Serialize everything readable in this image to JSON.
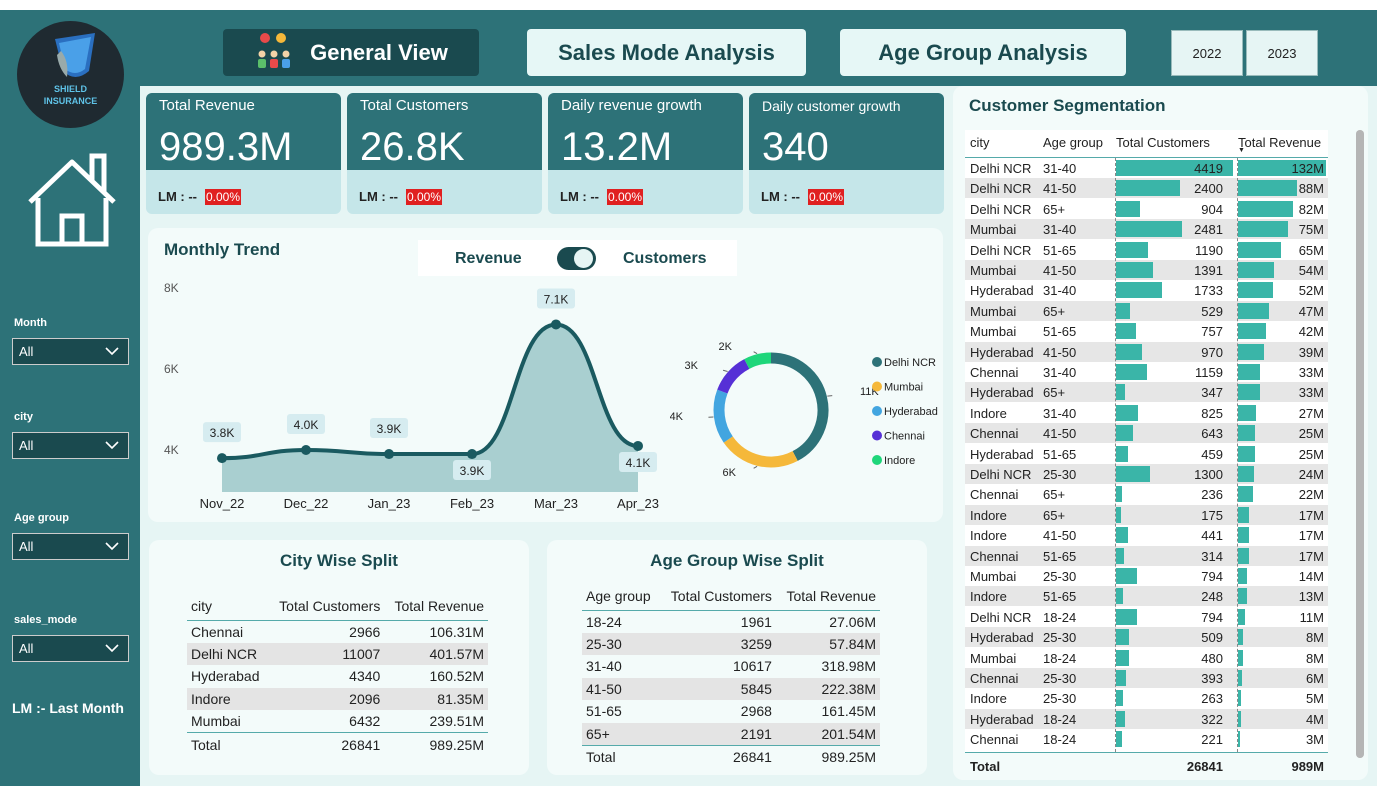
{
  "logo": {
    "text1": "SHIELD",
    "text2": "INSURANCE"
  },
  "nav": {
    "general": "General View",
    "sales": "Sales Mode Analysis",
    "age": "Age Group Analysis"
  },
  "years": [
    "2022",
    "2023"
  ],
  "kpis": [
    {
      "label": "Total Revenue",
      "value": "989.3M",
      "lm": "LM : --",
      "pct": "0.00%"
    },
    {
      "label": "Total Customers",
      "value": "26.8K",
      "lm": "LM : --",
      "pct": "0.00%"
    },
    {
      "label": "Daily revenue growth",
      "value": "13.2M",
      "lm": "LM : --",
      "pct": "0.00%"
    },
    {
      "label": "Daily customer growth",
      "value": "340",
      "lm": "LM : --",
      "pct": "0.00%"
    }
  ],
  "slicers": [
    {
      "label": "Month",
      "value": "All"
    },
    {
      "label": "city",
      "value": "All"
    },
    {
      "label": "Age group",
      "value": "All"
    },
    {
      "label": "sales_mode",
      "value": "All"
    }
  ],
  "lm_note": "LM :- Last Month",
  "monthly": {
    "title": "Monthly Trend",
    "toggle_left": "Revenue",
    "toggle_right": "Customers",
    "yticks": [
      "8K",
      "6K",
      "4K"
    ]
  },
  "chart_data": [
    {
      "type": "area",
      "title": "Monthly Trend",
      "x": [
        "Nov_22",
        "Dec_22",
        "Jan_23",
        "Feb_23",
        "Mar_23",
        "Apr_23"
      ],
      "values": [
        3.8,
        4.0,
        3.9,
        3.9,
        7.1,
        4.1
      ],
      "labels": [
        "3.8K",
        "4.0K",
        "3.9K",
        "3.9K",
        "7.1K",
        "4.1K"
      ],
      "yticks": [
        "8K",
        "6K",
        "4K"
      ],
      "color": "#1a5a60"
    },
    {
      "type": "pie",
      "categories": [
        "Delhi NCR",
        "Mumbai",
        "Hyderabad",
        "Chennai",
        "Indore"
      ],
      "values": [
        11,
        6,
        4,
        3,
        2
      ],
      "labels": [
        "11K",
        "6K",
        "4K",
        "3K",
        "2K"
      ],
      "colors": [
        "#2d7278",
        "#f5b83a",
        "#42a5e0",
        "#5630d6",
        "#1ed67a"
      ],
      "legend": "right"
    }
  ],
  "city_split": {
    "title": "City Wise Split",
    "headers": [
      "city",
      "Total Customers",
      "Total Revenue"
    ],
    "rows": [
      [
        "Chennai",
        "2966",
        "106.31M"
      ],
      [
        "Delhi NCR",
        "11007",
        "401.57M"
      ],
      [
        "Hyderabad",
        "4340",
        "160.52M"
      ],
      [
        "Indore",
        "2096",
        "81.35M"
      ],
      [
        "Mumbai",
        "6432",
        "239.51M"
      ]
    ],
    "total": [
      "Total",
      "26841",
      "989.25M"
    ]
  },
  "age_split": {
    "title": "Age Group Wise Split",
    "headers": [
      "Age group",
      "Total Customers",
      "Total Revenue"
    ],
    "rows": [
      [
        "18-24",
        "1961",
        "27.06M"
      ],
      [
        "25-30",
        "3259",
        "57.84M"
      ],
      [
        "31-40",
        "10617",
        "318.98M"
      ],
      [
        "41-50",
        "5845",
        "222.38M"
      ],
      [
        "51-65",
        "2968",
        "161.45M"
      ],
      [
        "65+",
        "2191",
        "201.54M"
      ]
    ],
    "total": [
      "Total",
      "26841",
      "989.25M"
    ]
  },
  "segmentation": {
    "title": "Customer Segmentation",
    "headers": [
      "city",
      "Age group",
      "Total Customers",
      "Total Revenue"
    ],
    "rows": [
      [
        "Delhi NCR",
        "31-40",
        4419,
        "132M",
        132
      ],
      [
        "Delhi NCR",
        "41-50",
        2400,
        "88M",
        88
      ],
      [
        "Delhi NCR",
        "65+",
        904,
        "82M",
        82
      ],
      [
        "Mumbai",
        "31-40",
        2481,
        "75M",
        75
      ],
      [
        "Delhi NCR",
        "51-65",
        1190,
        "65M",
        65
      ],
      [
        "Mumbai",
        "41-50",
        1391,
        "54M",
        54
      ],
      [
        "Hyderabad",
        "31-40",
        1733,
        "52M",
        52
      ],
      [
        "Mumbai",
        "65+",
        529,
        "47M",
        47
      ],
      [
        "Mumbai",
        "51-65",
        757,
        "42M",
        42
      ],
      [
        "Hyderabad",
        "41-50",
        970,
        "39M",
        39
      ],
      [
        "Chennai",
        "31-40",
        1159,
        "33M",
        33
      ],
      [
        "Hyderabad",
        "65+",
        347,
        "33M",
        33
      ],
      [
        "Indore",
        "31-40",
        825,
        "27M",
        27
      ],
      [
        "Chennai",
        "41-50",
        643,
        "25M",
        25
      ],
      [
        "Hyderabad",
        "51-65",
        459,
        "25M",
        25
      ],
      [
        "Delhi NCR",
        "25-30",
        1300,
        "24M",
        24
      ],
      [
        "Chennai",
        "65+",
        236,
        "22M",
        22
      ],
      [
        "Indore",
        "65+",
        175,
        "17M",
        17
      ],
      [
        "Indore",
        "41-50",
        441,
        "17M",
        17
      ],
      [
        "Chennai",
        "51-65",
        314,
        "17M",
        17
      ],
      [
        "Mumbai",
        "25-30",
        794,
        "14M",
        14
      ],
      [
        "Indore",
        "51-65",
        248,
        "13M",
        13
      ],
      [
        "Delhi NCR",
        "18-24",
        794,
        "11M",
        11
      ],
      [
        "Hyderabad",
        "25-30",
        509,
        "8M",
        8
      ],
      [
        "Mumbai",
        "18-24",
        480,
        "8M",
        8
      ],
      [
        "Chennai",
        "25-30",
        393,
        "6M",
        6
      ],
      [
        "Indore",
        "25-30",
        263,
        "5M",
        5
      ],
      [
        "Hyderabad",
        "18-24",
        322,
        "4M",
        4
      ],
      [
        "Chennai",
        "18-24",
        221,
        "3M",
        3
      ]
    ],
    "total": [
      "Total",
      "26841",
      "989M"
    ]
  }
}
